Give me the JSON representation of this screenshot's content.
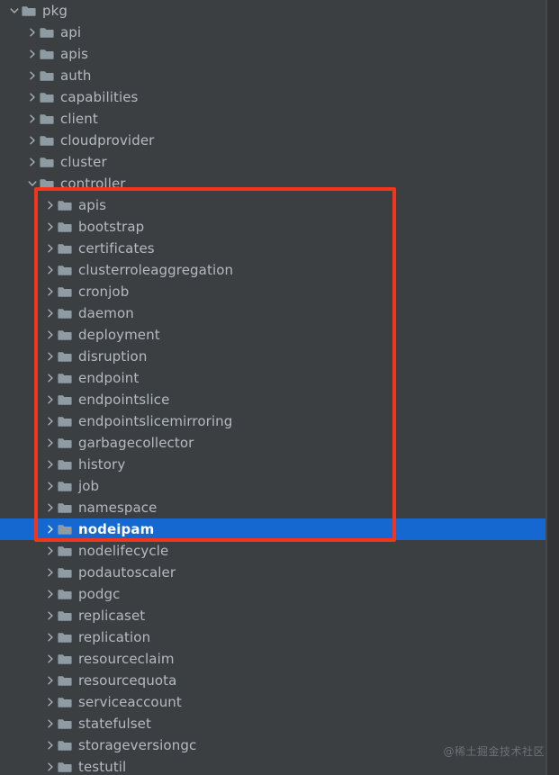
{
  "theme": {
    "background": "#3c3f41",
    "text": "#b4bbc0",
    "selection_background": "#1668d1",
    "selection_text": "#ffffff",
    "folder_icon": "#8e9ba3",
    "chevron": "#a9b0b5",
    "annotation_color": "#f4351d",
    "gutter": "#313335"
  },
  "annotation": {
    "shape": "rectangle",
    "color": "#f4351d"
  },
  "watermark": {
    "text": "@稀土掘金技术社区"
  },
  "tree": {
    "root_label": "pkg",
    "nodes": [
      {
        "label": "pkg",
        "depth": 0,
        "expanded": true,
        "icon": "folder-icon",
        "chevron": "chevron-down-icon",
        "selected": false
      },
      {
        "label": "api",
        "depth": 1,
        "expanded": false,
        "icon": "folder-icon",
        "chevron": "chevron-right-icon",
        "selected": false
      },
      {
        "label": "apis",
        "depth": 1,
        "expanded": false,
        "icon": "folder-icon",
        "chevron": "chevron-right-icon",
        "selected": false
      },
      {
        "label": "auth",
        "depth": 1,
        "expanded": false,
        "icon": "folder-icon",
        "chevron": "chevron-right-icon",
        "selected": false
      },
      {
        "label": "capabilities",
        "depth": 1,
        "expanded": false,
        "icon": "folder-icon",
        "chevron": "chevron-right-icon",
        "selected": false
      },
      {
        "label": "client",
        "depth": 1,
        "expanded": false,
        "icon": "folder-icon",
        "chevron": "chevron-right-icon",
        "selected": false
      },
      {
        "label": "cloudprovider",
        "depth": 1,
        "expanded": false,
        "icon": "folder-icon",
        "chevron": "chevron-right-icon",
        "selected": false
      },
      {
        "label": "cluster",
        "depth": 1,
        "expanded": false,
        "icon": "folder-icon",
        "chevron": "chevron-right-icon",
        "selected": false
      },
      {
        "label": "controller",
        "depth": 1,
        "expanded": true,
        "icon": "folder-icon",
        "chevron": "chevron-down-icon",
        "selected": false
      },
      {
        "label": "apis",
        "depth": 2,
        "expanded": false,
        "icon": "folder-icon",
        "chevron": "chevron-right-icon",
        "selected": false
      },
      {
        "label": "bootstrap",
        "depth": 2,
        "expanded": false,
        "icon": "folder-icon",
        "chevron": "chevron-right-icon",
        "selected": false
      },
      {
        "label": "certificates",
        "depth": 2,
        "expanded": false,
        "icon": "folder-icon",
        "chevron": "chevron-right-icon",
        "selected": false
      },
      {
        "label": "clusterroleaggregation",
        "depth": 2,
        "expanded": false,
        "icon": "folder-icon",
        "chevron": "chevron-right-icon",
        "selected": false
      },
      {
        "label": "cronjob",
        "depth": 2,
        "expanded": false,
        "icon": "folder-icon",
        "chevron": "chevron-right-icon",
        "selected": false
      },
      {
        "label": "daemon",
        "depth": 2,
        "expanded": false,
        "icon": "folder-icon",
        "chevron": "chevron-right-icon",
        "selected": false
      },
      {
        "label": "deployment",
        "depth": 2,
        "expanded": false,
        "icon": "folder-icon",
        "chevron": "chevron-right-icon",
        "selected": false
      },
      {
        "label": "disruption",
        "depth": 2,
        "expanded": false,
        "icon": "folder-icon",
        "chevron": "chevron-right-icon",
        "selected": false
      },
      {
        "label": "endpoint",
        "depth": 2,
        "expanded": false,
        "icon": "folder-icon",
        "chevron": "chevron-right-icon",
        "selected": false
      },
      {
        "label": "endpointslice",
        "depth": 2,
        "expanded": false,
        "icon": "folder-icon",
        "chevron": "chevron-right-icon",
        "selected": false
      },
      {
        "label": "endpointslicemirroring",
        "depth": 2,
        "expanded": false,
        "icon": "folder-icon",
        "chevron": "chevron-right-icon",
        "selected": false
      },
      {
        "label": "garbagecollector",
        "depth": 2,
        "expanded": false,
        "icon": "folder-icon",
        "chevron": "chevron-right-icon",
        "selected": false
      },
      {
        "label": "history",
        "depth": 2,
        "expanded": false,
        "icon": "folder-icon",
        "chevron": "chevron-right-icon",
        "selected": false
      },
      {
        "label": "job",
        "depth": 2,
        "expanded": false,
        "icon": "folder-icon",
        "chevron": "chevron-right-icon",
        "selected": false
      },
      {
        "label": "namespace",
        "depth": 2,
        "expanded": false,
        "icon": "folder-icon",
        "chevron": "chevron-right-icon",
        "selected": false
      },
      {
        "label": "nodeipam",
        "depth": 2,
        "expanded": false,
        "icon": "folder-icon",
        "chevron": "chevron-right-icon",
        "selected": true
      },
      {
        "label": "nodelifecycle",
        "depth": 2,
        "expanded": false,
        "icon": "folder-icon",
        "chevron": "chevron-right-icon",
        "selected": false
      },
      {
        "label": "podautoscaler",
        "depth": 2,
        "expanded": false,
        "icon": "folder-icon",
        "chevron": "chevron-right-icon",
        "selected": false
      },
      {
        "label": "podgc",
        "depth": 2,
        "expanded": false,
        "icon": "folder-icon",
        "chevron": "chevron-right-icon",
        "selected": false
      },
      {
        "label": "replicaset",
        "depth": 2,
        "expanded": false,
        "icon": "folder-icon",
        "chevron": "chevron-right-icon",
        "selected": false
      },
      {
        "label": "replication",
        "depth": 2,
        "expanded": false,
        "icon": "folder-icon",
        "chevron": "chevron-right-icon",
        "selected": false
      },
      {
        "label": "resourceclaim",
        "depth": 2,
        "expanded": false,
        "icon": "folder-icon",
        "chevron": "chevron-right-icon",
        "selected": false
      },
      {
        "label": "resourcequota",
        "depth": 2,
        "expanded": false,
        "icon": "folder-icon",
        "chevron": "chevron-right-icon",
        "selected": false
      },
      {
        "label": "serviceaccount",
        "depth": 2,
        "expanded": false,
        "icon": "folder-icon",
        "chevron": "chevron-right-icon",
        "selected": false
      },
      {
        "label": "statefulset",
        "depth": 2,
        "expanded": false,
        "icon": "folder-icon",
        "chevron": "chevron-right-icon",
        "selected": false
      },
      {
        "label": "storageversiongc",
        "depth": 2,
        "expanded": false,
        "icon": "folder-icon",
        "chevron": "chevron-right-icon",
        "selected": false
      },
      {
        "label": "testutil",
        "depth": 2,
        "expanded": false,
        "icon": "folder-icon",
        "chevron": "chevron-right-icon",
        "selected": false
      }
    ]
  }
}
